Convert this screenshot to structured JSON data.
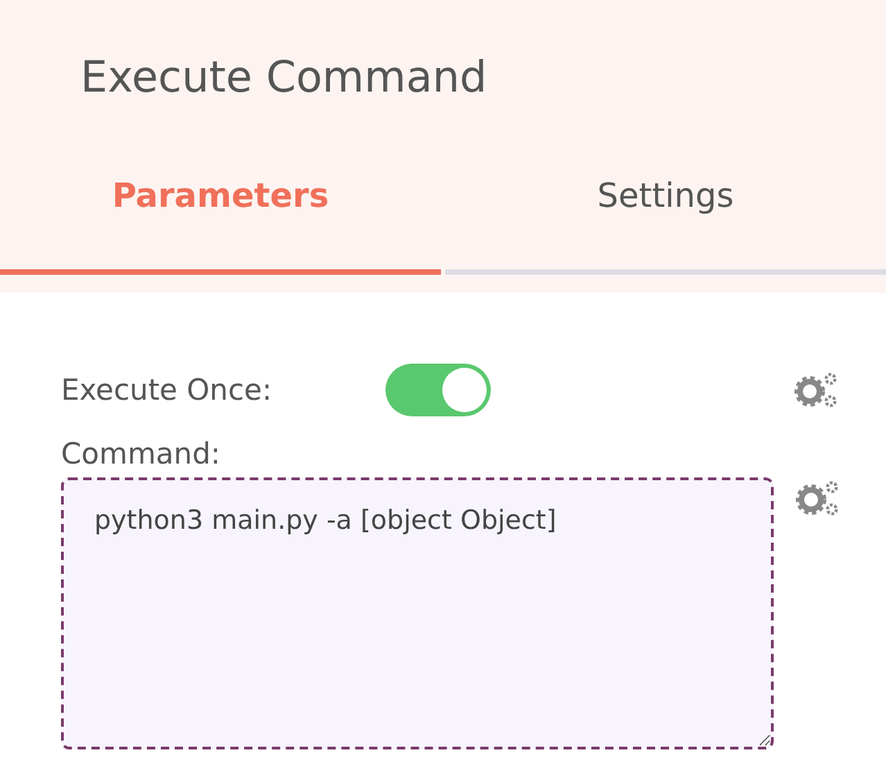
{
  "window": {
    "title": "Execute Command"
  },
  "tabs": [
    {
      "label": "Parameters",
      "selected": true
    },
    {
      "label": "Settings",
      "selected": false
    }
  ],
  "parameters": [
    {
      "kind": "toggle",
      "label": "Execute Once:",
      "on": true
    },
    {
      "kind": "text",
      "label": "Command:",
      "value": "python3 main.py -a [object Object]"
    }
  ]
}
